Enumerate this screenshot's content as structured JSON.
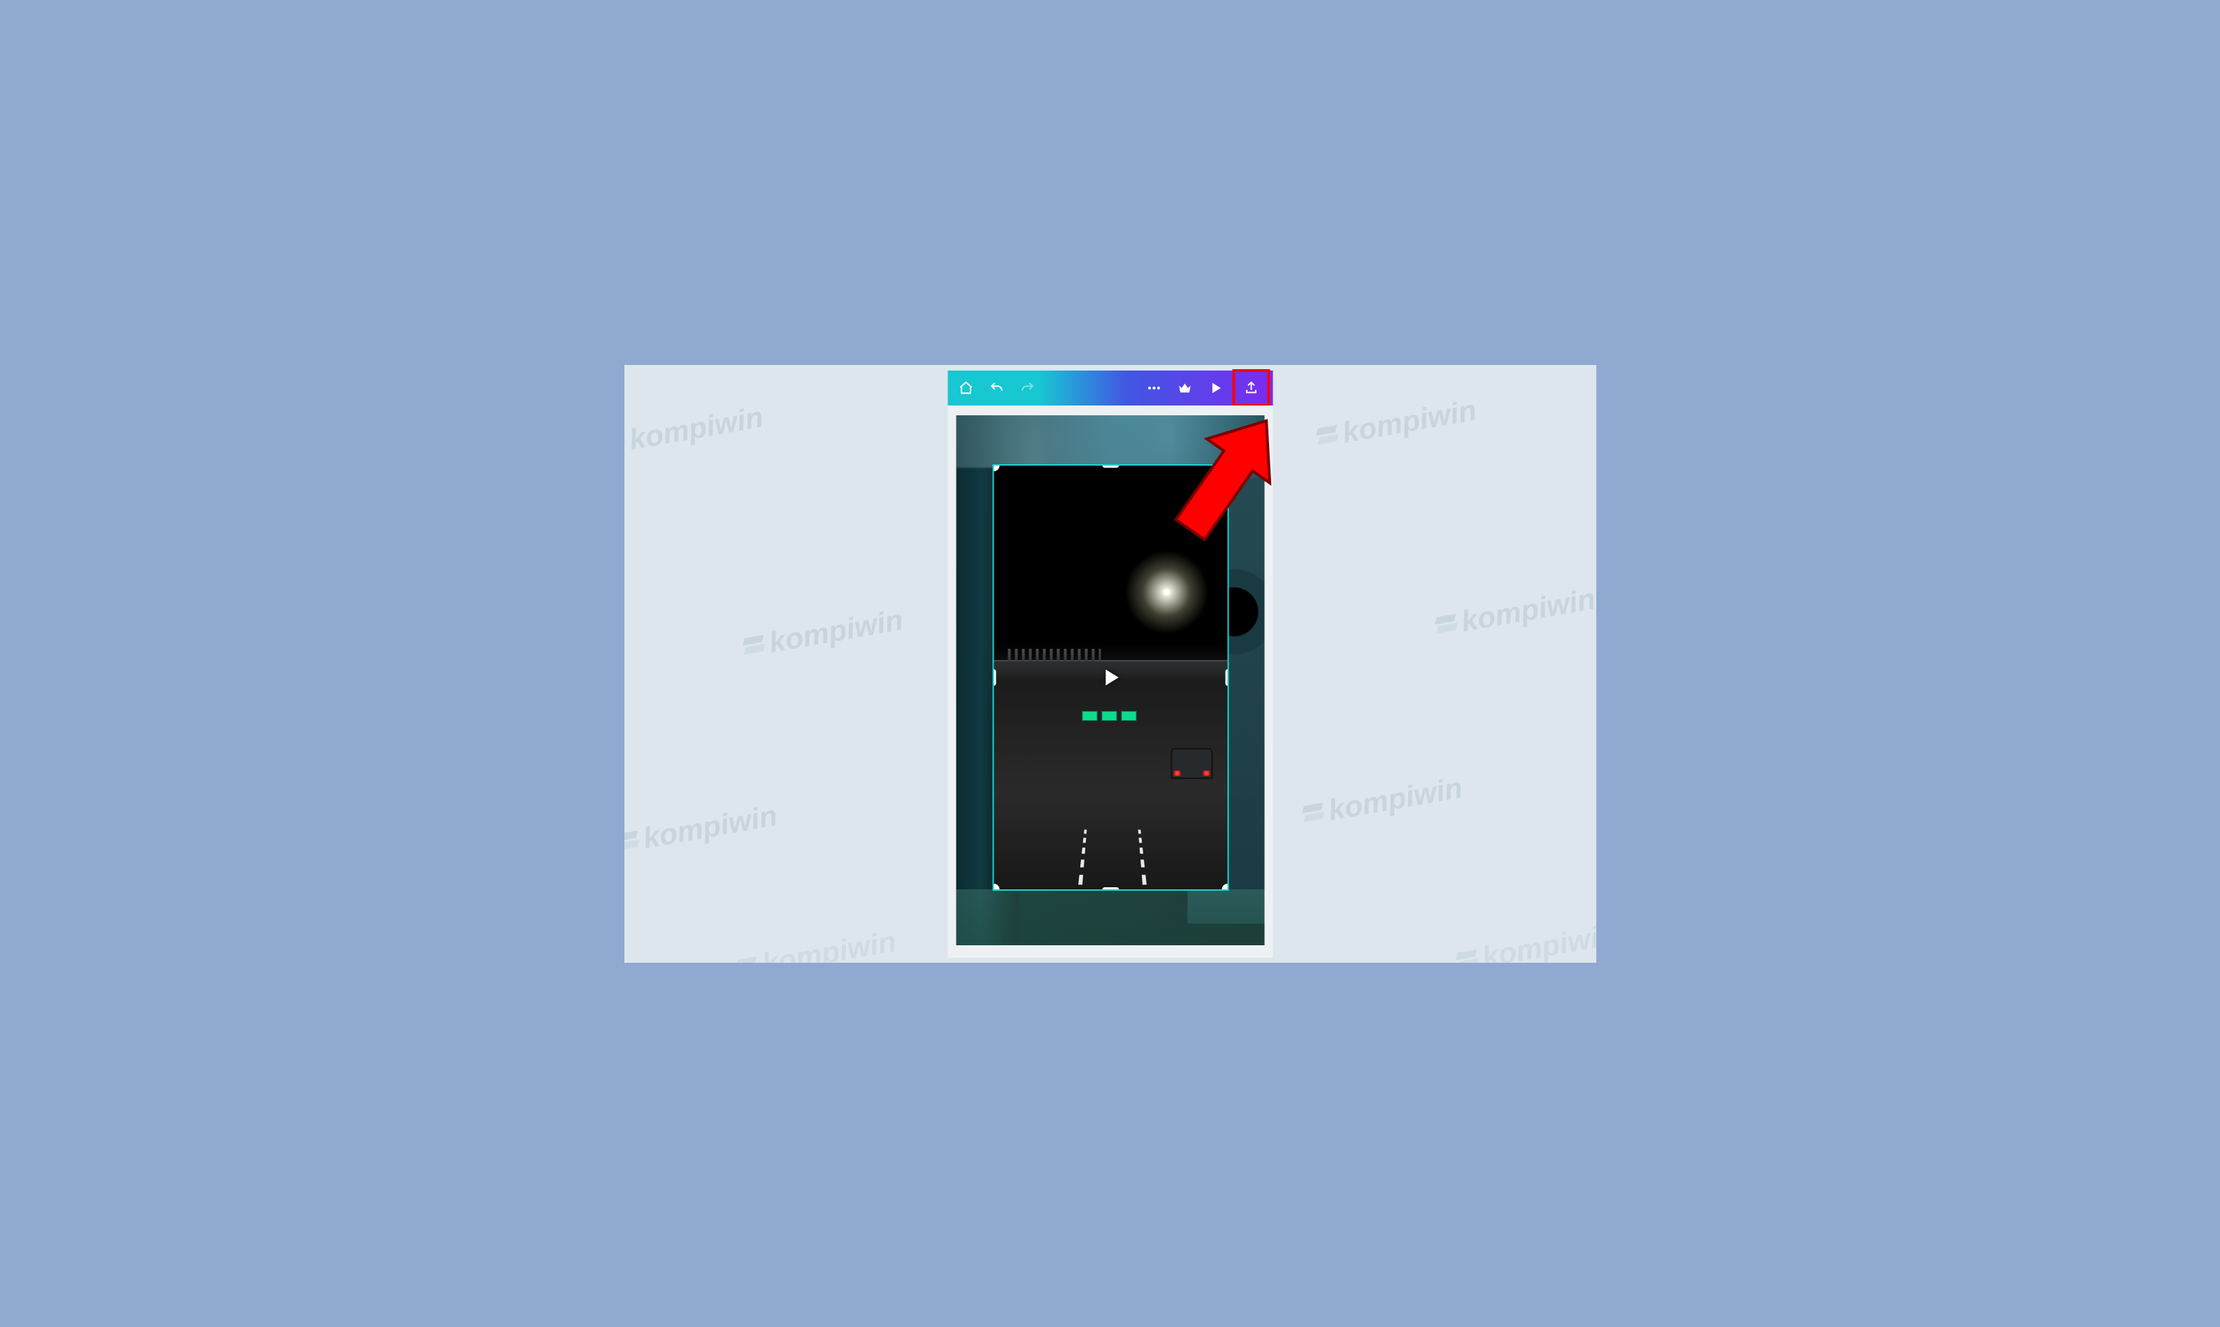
{
  "watermark_text": "kompiwin",
  "toolbar": {
    "home": "home-icon",
    "undo": "undo-icon",
    "redo": "redo-icon",
    "more": "more-icon",
    "premium": "crown-icon",
    "play": "play-icon",
    "export": "export-icon"
  },
  "annotation": {
    "highlight_target": "export-button",
    "highlight_color": "#ff0000"
  },
  "canvas": {
    "selected_element": "video-clip",
    "overlay_icon": "play-icon",
    "floating_action": "swap-icon"
  }
}
